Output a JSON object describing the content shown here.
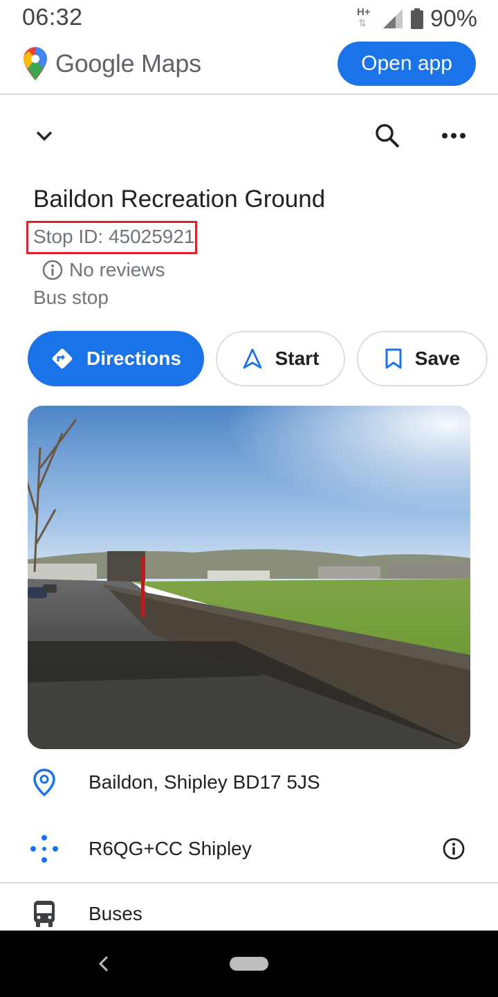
{
  "status_bar": {
    "time": "06:32",
    "network_type": "H+",
    "battery_percent": "90%",
    "icons": [
      "network-h-plus-icon",
      "signal-icon",
      "battery-icon"
    ]
  },
  "header": {
    "logo_text": "Google Maps",
    "open_app_label": "Open app",
    "accent_color": "#1a73e8"
  },
  "toolbar": {
    "icons": [
      "chevron-down-icon",
      "search-icon",
      "more-icon"
    ]
  },
  "place": {
    "title": "Baildon Recreation Ground",
    "stop_id": "Stop ID: 45025921",
    "reviews": "No reviews",
    "category": "Bus stop",
    "highlight_color": "#e0202a"
  },
  "actions": {
    "directions_label": "Directions",
    "start_label": "Start",
    "save_label": "Save"
  },
  "info": {
    "address": "Baildon, Shipley BD17 5JS",
    "plus_code": "R6QG+CC Shipley",
    "transit_label": "Buses"
  }
}
